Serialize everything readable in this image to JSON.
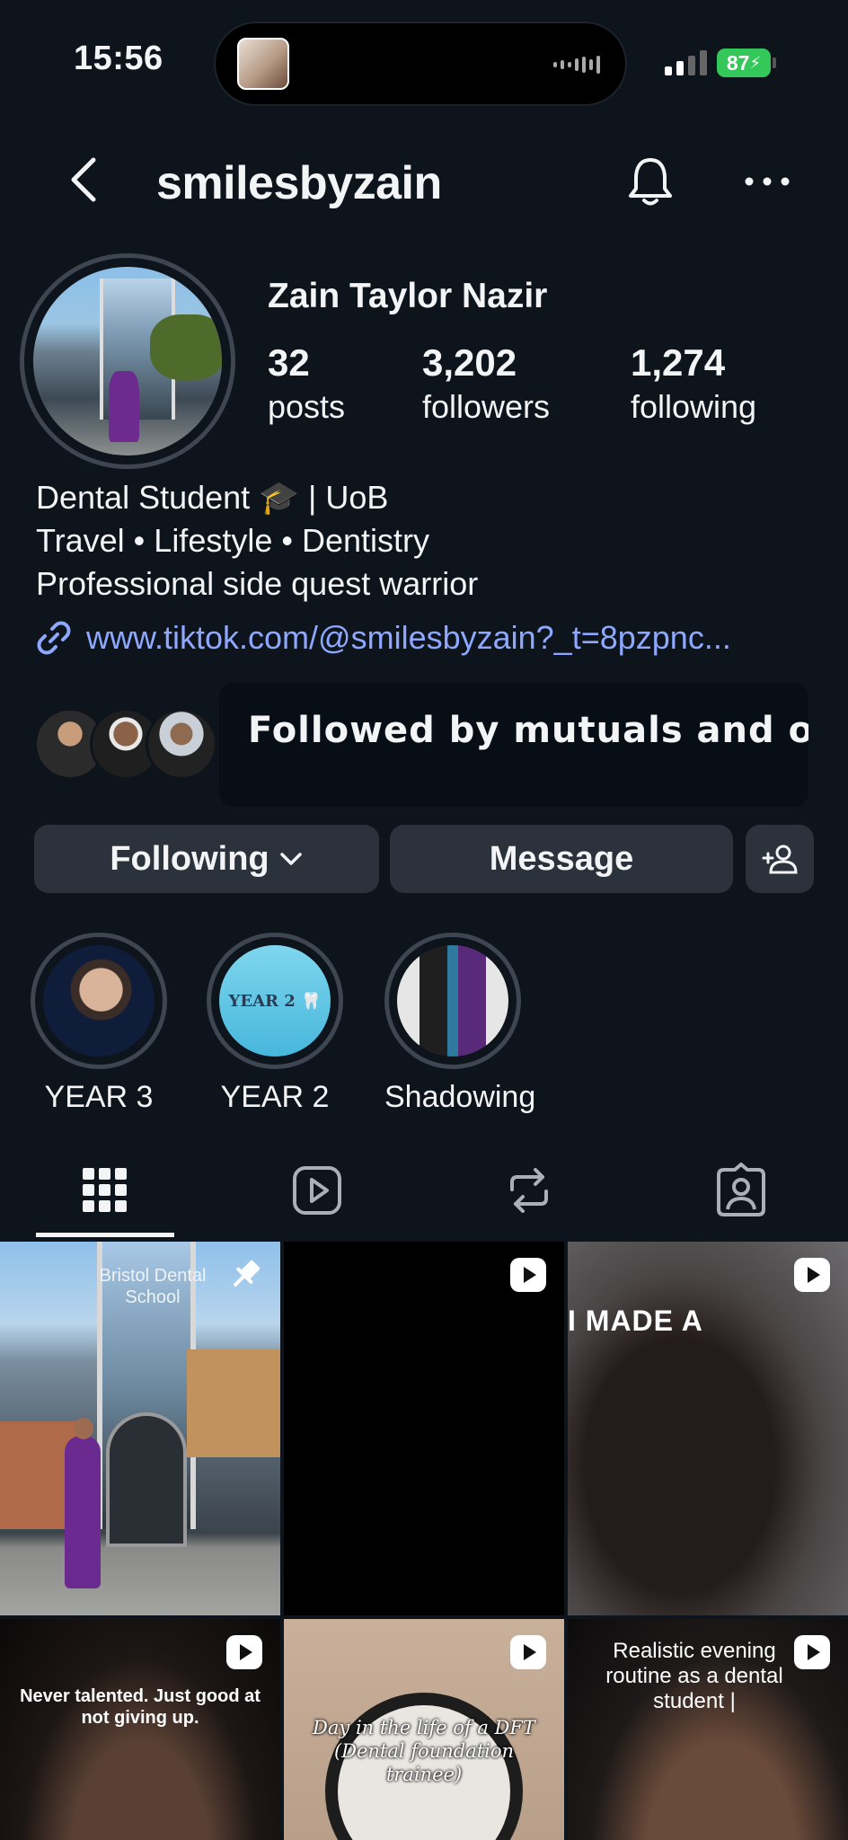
{
  "status_bar": {
    "time": "15:56",
    "battery": "87"
  },
  "header": {
    "username": "smilesbyzain"
  },
  "profile": {
    "full_name": "Zain Taylor Nazir",
    "stats": [
      {
        "value": "32",
        "label": "posts"
      },
      {
        "value": "3,202",
        "label": "followers"
      },
      {
        "value": "1,274",
        "label": "following"
      }
    ],
    "bio": [
      "Dental Student 🎓 | UoB",
      "Travel • Lifestyle • Dentistry",
      "Professional side quest warrior"
    ],
    "link": "www.tiktok.com/@smilesbyzain?_t=8pzpnc...",
    "mutuals_text": "Followed by mutuals and others"
  },
  "actions": {
    "following": "Following",
    "message": "Message"
  },
  "highlights": [
    {
      "label": "YEAR 3"
    },
    {
      "label": "YEAR 2",
      "cover_text": "YEAR 2 🦷"
    },
    {
      "label": "Shadowing"
    }
  ],
  "grid": {
    "posts": [
      {
        "overlay_text": "Bristol Dental School"
      },
      {
        "overlay_text": ""
      },
      {
        "overlay_text": "I MADE A"
      },
      {
        "overlay_text": "Never talented. Just good at not giving up."
      },
      {
        "overlay_text": "Day in the life of a DFT (Dental foundation trainee)"
      },
      {
        "overlay_text": "Realistic evening routine as a dental student |"
      }
    ]
  },
  "colors": {
    "background": "#0e141b",
    "button": "#2b323b",
    "link": "#8fa8ff",
    "battery": "#34c759"
  }
}
